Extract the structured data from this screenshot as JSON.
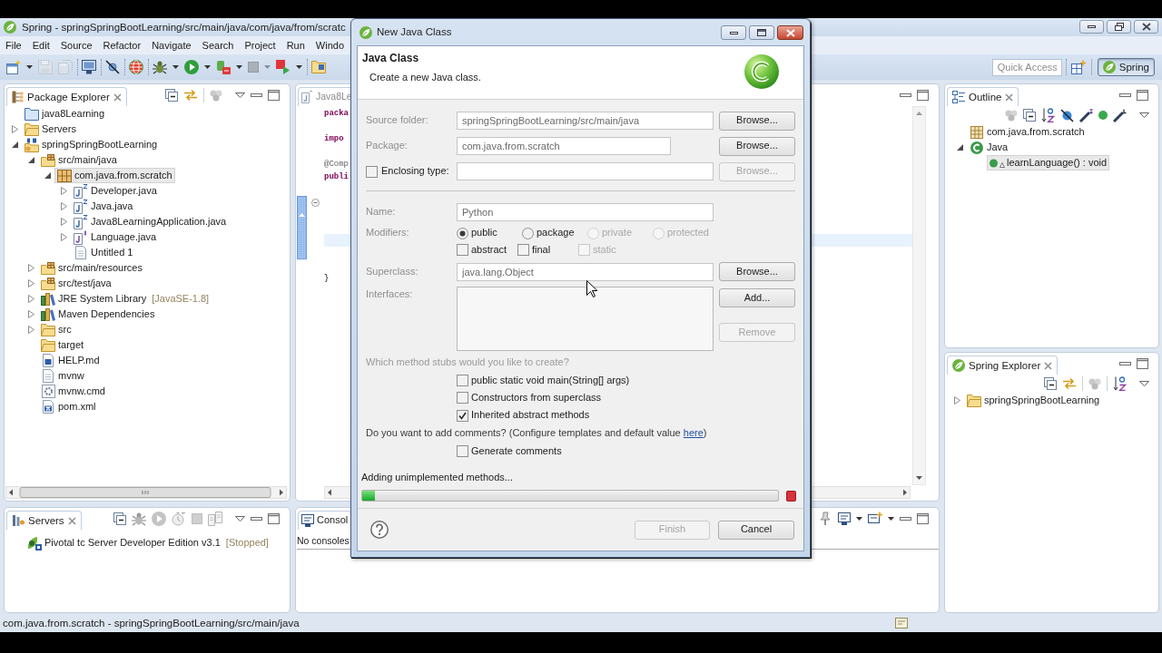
{
  "window": {
    "title": "Spring - springSpringBootLearning/src/main/java/com/java/from/scratc"
  },
  "menu": [
    "File",
    "Edit",
    "Source",
    "Refactor",
    "Navigate",
    "Search",
    "Project",
    "Run",
    "Windo"
  ],
  "toolbar": [
    {
      "kind": "new",
      "dropdown": true,
      "disabled": false
    },
    {
      "kind": "save",
      "dropdown": false,
      "disabled": true
    },
    {
      "kind": "saveall",
      "dropdown": false,
      "disabled": true
    },
    {
      "kind": "separator"
    },
    {
      "kind": "terminal",
      "dropdown": false,
      "disabled": false
    },
    {
      "kind": "separator"
    },
    {
      "kind": "skipbreakpoints",
      "dropdown": false,
      "disabled": false
    },
    {
      "kind": "separator"
    },
    {
      "kind": "dashboard",
      "dropdown": false,
      "disabled": false
    },
    {
      "kind": "separator"
    },
    {
      "kind": "debug",
      "dropdown": true,
      "disabled": false
    },
    {
      "kind": "run",
      "dropdown": true,
      "disabled": false
    },
    {
      "kind": "server",
      "dropdown": true,
      "disabled": false
    },
    {
      "kind": "stop",
      "dropdown": true,
      "disabled": true
    },
    {
      "kind": "external",
      "dropdown": true,
      "disabled": false
    },
    {
      "kind": "separator"
    },
    {
      "kind": "newfolder",
      "dropdown": false,
      "disabled": false
    }
  ],
  "quick_access": {
    "placeholder": "Quick Access"
  },
  "perspective": {
    "label": "Spring",
    "selected": true
  },
  "package_explorer": {
    "title": "Package Explorer",
    "tree": [
      {
        "label": "java8Learning",
        "kind": "closedproject",
        "selected": false
      },
      {
        "label": "Servers",
        "kind": "folder",
        "expanded": false,
        "selected": false
      },
      {
        "label": "springSpringBootLearning",
        "kind": "springproject",
        "expanded": true,
        "selected": false,
        "children": [
          {
            "label": "src/main/java",
            "kind": "sourcefolder",
            "expanded": true,
            "selected": false,
            "children": [
              {
                "label": "com.java.from.scratch",
                "kind": "package",
                "expanded": true,
                "selected": true,
                "children": [
                  {
                    "label": "Developer.java",
                    "kind": "class",
                    "expanded": false,
                    "selected": false
                  },
                  {
                    "label": "Java.java",
                    "kind": "class",
                    "expanded": false,
                    "selected": false
                  },
                  {
                    "label": "Java8LearningApplication.java",
                    "kind": "class",
                    "expanded": false,
                    "selected": false
                  },
                  {
                    "label": "Language.java",
                    "kind": "interface",
                    "expanded": false,
                    "selected": false
                  },
                  {
                    "label": "Untitled 1",
                    "kind": "file",
                    "selected": false
                  }
                ]
              }
            ]
          },
          {
            "label": "src/main/resources",
            "kind": "sourcefolder",
            "expanded": false,
            "selected": false
          },
          {
            "label": "src/test/java",
            "kind": "sourcefolder",
            "expanded": false,
            "selected": false
          },
          {
            "label": "JRE System Library",
            "decoration": "[JavaSE-1.8]",
            "kind": "library",
            "expanded": false,
            "selected": false
          },
          {
            "label": "Maven Dependencies",
            "kind": "library",
            "expanded": false,
            "selected": false
          },
          {
            "label": "src",
            "kind": "folder",
            "expanded": false,
            "selected": false
          },
          {
            "label": "target",
            "kind": "folder",
            "selected": false
          },
          {
            "label": "HELP.md",
            "kind": "markdown",
            "selected": false
          },
          {
            "label": "mvnw",
            "kind": "file",
            "selected": false
          },
          {
            "label": "mvnw.cmd",
            "kind": "script",
            "selected": false
          },
          {
            "label": "pom.xml",
            "kind": "pom",
            "selected": false
          }
        ]
      }
    ]
  },
  "editor": {
    "tab": "Java8Le",
    "lines": [
      {
        "kind": "keyword",
        "text": "packa"
      },
      {
        "kind": "blank"
      },
      {
        "kind": "keyword",
        "text": "impo"
      },
      {
        "kind": "blank"
      },
      {
        "kind": "annotation",
        "text": "@Comp"
      },
      {
        "kind": "keyword",
        "text": "publi"
      },
      {
        "kind": "blank"
      },
      {
        "kind": "fold"
      },
      {
        "kind": "blank"
      },
      {
        "kind": "blank"
      },
      {
        "kind": "current"
      },
      {
        "kind": "blank"
      },
      {
        "kind": "blank"
      },
      {
        "kind": "plain",
        "text": "}"
      }
    ]
  },
  "outline": {
    "title": "Outline",
    "tree": [
      {
        "label": "com.java.from.scratch",
        "kind": "packagedecl",
        "selected": false
      },
      {
        "label": "Java",
        "kind": "type",
        "expanded": true,
        "selected": false,
        "children": [
          {
            "label": "learnLanguage() : void",
            "kind": "method",
            "selected": true
          }
        ]
      }
    ]
  },
  "spring_explorer": {
    "title": "Spring Explorer",
    "tree": [
      {
        "label": "springSpringBootLearning",
        "kind": "folder",
        "expanded": false,
        "selected": false
      }
    ]
  },
  "servers": {
    "title": "Servers",
    "items": [
      {
        "label": "Pivotal tc Server Developer Edition v3.1",
        "decoration": "[Stopped]",
        "selected": false
      }
    ]
  },
  "console": {
    "title": "Consol",
    "message": "No consoles"
  },
  "status_bar": {
    "text": "com.java.from.scratch - springSpringBootLearning/src/main/java"
  },
  "dialog": {
    "title": "New Java Class",
    "heading": "Java Class",
    "description": "Create a new Java class.",
    "source_folder": {
      "label": "Source folder:",
      "value": "springSpringBootLearning/src/main/java",
      "button": {
        "label": "Browse...",
        "disabled": false
      }
    },
    "package": {
      "label": "Package:",
      "value": "com.java.from.scratch",
      "button": {
        "label": "Browse...",
        "disabled": false
      }
    },
    "enclosing_type": {
      "label": "Enclosing type:",
      "checked": false,
      "button": {
        "label": "Browse...",
        "disabled": true
      }
    },
    "name": {
      "label": "Name:",
      "value": "Python"
    },
    "modifiers": {
      "label": "Modifiers:",
      "access": [
        {
          "label": "public",
          "selected": true,
          "disabled": false
        },
        {
          "label": "package",
          "selected": false,
          "disabled": false
        },
        {
          "label": "private",
          "selected": false,
          "disabled": true
        },
        {
          "label": "protected",
          "selected": false,
          "disabled": true
        }
      ],
      "flags": [
        {
          "label": "abstract",
          "checked": false,
          "disabled": false
        },
        {
          "label": "final",
          "checked": false,
          "disabled": false
        },
        {
          "label": "static",
          "checked": false,
          "disabled": true
        }
      ]
    },
    "superclass": {
      "label": "Superclass:",
      "value": "java.lang.Object",
      "button": {
        "label": "Browse...",
        "disabled": false
      }
    },
    "interfaces": {
      "label": "Interfaces:",
      "buttons": [
        {
          "label": "Add...",
          "disabled": false
        },
        {
          "label": "Remove",
          "disabled": true
        }
      ]
    },
    "stubs": {
      "question": "Which method stubs would you like to create?",
      "options": [
        {
          "label": "public static void main(String[] args)",
          "checked": false
        },
        {
          "label": "Constructors from superclass",
          "checked": false
        },
        {
          "label": "Inherited abstract methods",
          "checked": true
        }
      ]
    },
    "comments": {
      "prompt": "Do you want to add comments? (Configure templates and default value ",
      "link": "here",
      "closing": ")",
      "option": {
        "label": "Generate comments",
        "checked": false
      }
    },
    "progress": {
      "label": "Adding unimplemented methods...",
      "level": 0.03
    },
    "buttons": [
      {
        "label": "Finish",
        "disabled": true
      },
      {
        "label": "Cancel",
        "disabled": false
      }
    ]
  }
}
